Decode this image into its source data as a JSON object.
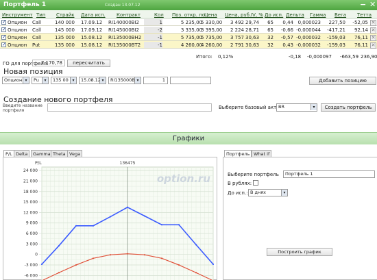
{
  "window": {
    "title": "Портфель 1",
    "created": "Создан 13.07.12",
    "minimize_icon": "minimize-icon",
    "close_icon": "close-icon",
    "minimize_glyph": "−",
    "close_glyph": "✕"
  },
  "table": {
    "headers": [
      "Инструмент",
      "Тип",
      "Страйк",
      "Дата исп.",
      "Контракт",
      "Кол",
      "Поз. откр. по",
      "Цена",
      "Цена, руб.",
      "IV, %",
      "До исп.",
      "Дельта",
      "Гамма",
      "Вега",
      "Тетта"
    ],
    "rows": [
      {
        "checked": true,
        "instrument": "Опцион",
        "type": "Call",
        "strike": "140 000",
        "date": "17.09.12",
        "contract": "RI140000BI2",
        "qty": "1",
        "open": "5 235,00",
        "price": "5 330,00",
        "price_rub": "3 492",
        "iv": "29,74",
        "days": "65",
        "delta": "0,44",
        "gamma": "0,000023",
        "vega": "227,50",
        "theta": "-52,05"
      },
      {
        "checked": true,
        "instrument": "Опцион",
        "type": "Call",
        "strike": "145 000",
        "date": "17.09.12",
        "contract": "RI145000BI2",
        "qty": "-2",
        "open": "3 335,00",
        "price": "3 395,00",
        "price_rub": "2 224",
        "iv": "28,71",
        "days": "65",
        "delta": "-0,66",
        "gamma": "-0,000044",
        "vega": "-417,21",
        "theta": "92,14"
      },
      {
        "checked": true,
        "instrument": "Опцион",
        "type": "Call",
        "strike": "135 000",
        "date": "15.08.12",
        "contract": "RI135000BH2",
        "qty": "-1",
        "open": "5 735,00",
        "price": "5 735,00",
        "price_rub": "3 757",
        "iv": "30,63",
        "days": "32",
        "delta": "-0,57",
        "gamma": "-0,000032",
        "vega": "-159,03",
        "theta": "76,11"
      },
      {
        "checked": true,
        "instrument": "Опцион",
        "type": "Put",
        "strike": "135 000",
        "date": "15.08.12",
        "contract": "RI135000BT2",
        "qty": "-1",
        "open": "4 260,00",
        "price": "4 260,00",
        "price_rub": "2 791",
        "iv": "30,63",
        "days": "32",
        "delta": "0,43",
        "gamma": "-0,000032",
        "vega": "-159,03",
        "theta": "76,11"
      }
    ],
    "totals": {
      "label": "Итого:",
      "pct": "0,12%",
      "delta": "-0,18",
      "gamma": "-0,000097",
      "vega": "-663,59",
      "theta": "236,90"
    },
    "row_remove_glyph": "✕",
    "check_glyph": "✓"
  },
  "go": {
    "label": "ГО для портфеля:",
    "value": "7 170,78",
    "recalc_label": "пересчитать"
  },
  "new_position": {
    "title": "Новая позиция",
    "instrument": "Опцион",
    "type": "Pu",
    "strike": "135 00",
    "date": "15.08.12",
    "contract": "RI135000B",
    "qty": "1",
    "add_label": "Добавить позицию"
  },
  "create_portfolio": {
    "title": "Создание нового портфеля",
    "name_label": "Введите название портфеля",
    "base_label": "Выберите базовый актив",
    "base_value": "BR",
    "create_label": "Создать портфель"
  },
  "graphs": {
    "title": "Графики",
    "tabs": [
      "P/L",
      "Delta",
      "Gamma",
      "Theta",
      "Vega"
    ],
    "active_tab": 0,
    "right_tabs": [
      "Портфель",
      "What if"
    ],
    "right_active_tab": 0,
    "portfolio_label": "Выберите портфель",
    "portfolio_value": "Портфель 1",
    "rubles_label": "В рублях:",
    "expiry_label": "До исп.:",
    "expiry_value": "В днях",
    "build_label": "Построить график",
    "dropdown_glyph": "▾"
  },
  "chart_data": {
    "type": "line",
    "ylabel": "P/L",
    "annotation": "136475",
    "watermark": "option.ru",
    "ylim": [
      -7500,
      25000
    ],
    "yticks": [
      "24 000",
      "21 000",
      "18 000",
      "15 000",
      "12 000",
      "9 000",
      "6 000",
      "3 000",
      "0",
      "-3 000",
      "-6 000"
    ],
    "ytick_values": [
      24000,
      21000,
      18000,
      15000,
      12000,
      9000,
      6000,
      3000,
      0,
      -3000,
      -6000
    ],
    "x": [
      0,
      1,
      2,
      3,
      4,
      5,
      6,
      7,
      8,
      9,
      10
    ],
    "xlim": [
      0,
      10
    ],
    "marker_x": 5,
    "grid": true,
    "series": [
      {
        "color": "#3b5bff",
        "values": [
          -2800,
          2500,
          8200,
          8200,
          10800,
          13500,
          11000,
          8500,
          8500,
          2800,
          -2800
        ]
      },
      {
        "color": "#e05038",
        "values": [
          -7500,
          -5200,
          -3000,
          -1100,
          -100,
          200,
          -100,
          -1100,
          -3000,
          -5200,
          -7500
        ]
      }
    ]
  }
}
